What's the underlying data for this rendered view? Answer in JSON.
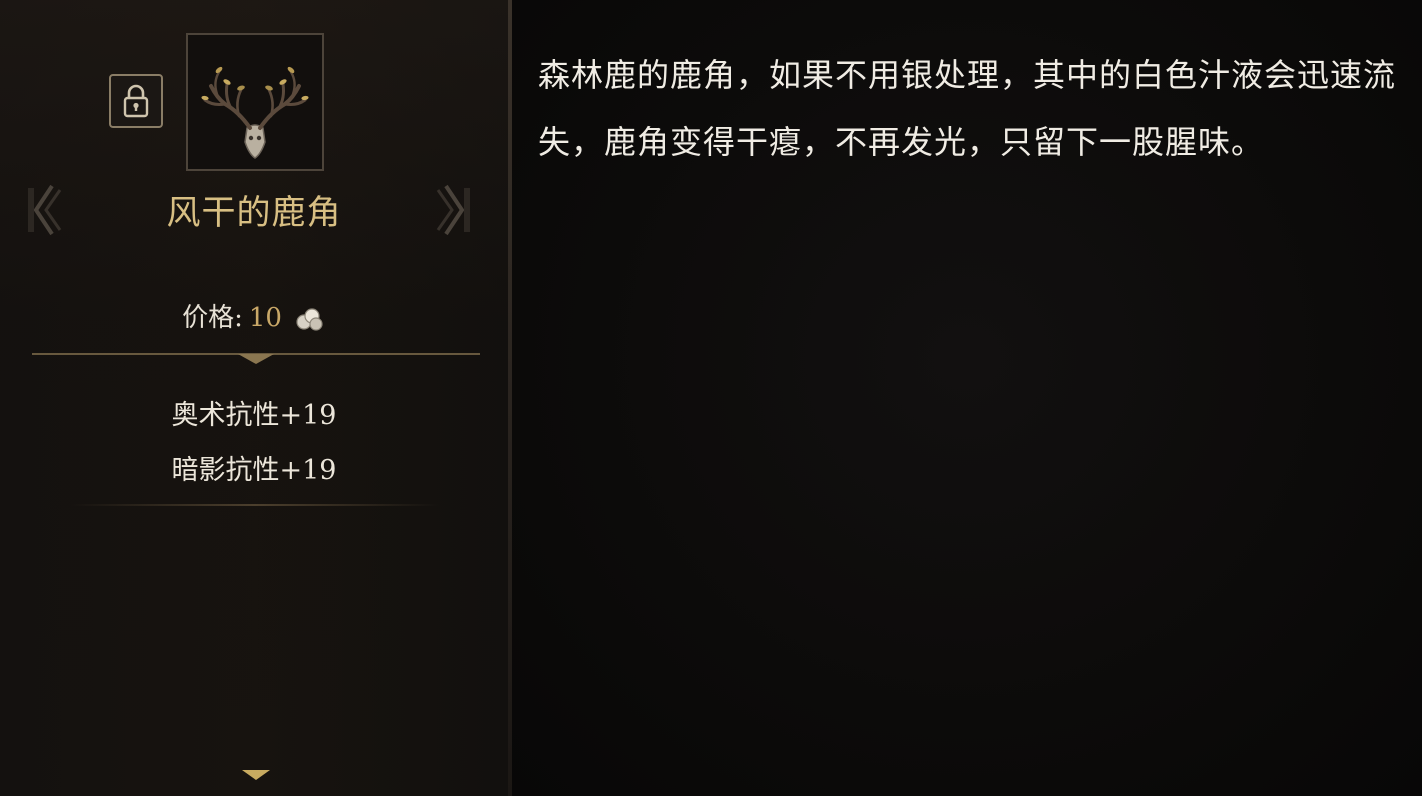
{
  "item": {
    "name": "风干的鹿角",
    "icon": "antler-icon",
    "locked": true,
    "price_label": "价格:",
    "price_value": "10",
    "currency_icon": "coin-icon",
    "stats": [
      "奥术抗性+19",
      "暗影抗性+19"
    ]
  },
  "description": {
    "text": "森林鹿的鹿角，如果不用银处理，其中的白色汁液会迅速流失，鹿角变得干瘪，不再发光，只留下一股腥味。"
  },
  "colors": {
    "item_name": "#d8bf83",
    "price_value": "#c9a868",
    "body_text": "#f0ece4",
    "frame_border": "#8a7d66"
  }
}
